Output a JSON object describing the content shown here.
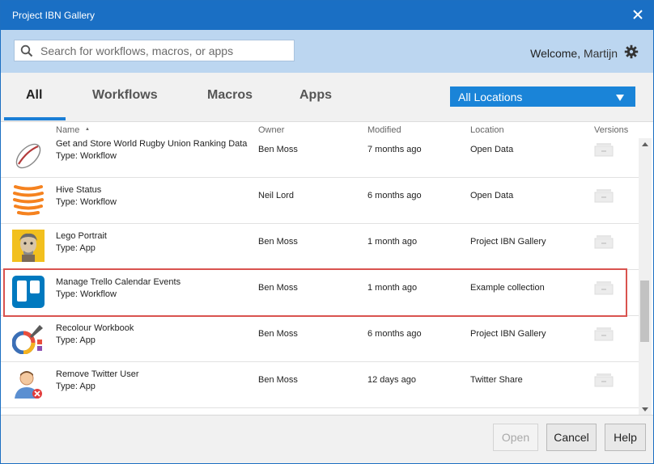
{
  "window": {
    "title": "Project IBN Gallery"
  },
  "search": {
    "placeholder": "Search for workflows, macros, or apps"
  },
  "user": {
    "welcome_label": "Welcome,",
    "name": "Martijn"
  },
  "tabs": [
    {
      "label": "All",
      "active": true
    },
    {
      "label": "Workflows",
      "active": false
    },
    {
      "label": "Macros",
      "active": false
    },
    {
      "label": "Apps",
      "active": false
    }
  ],
  "location_filter": {
    "selected": "All Locations"
  },
  "columns": {
    "name": "Name",
    "sort_indicator": "▲",
    "owner": "Owner",
    "modified": "Modified",
    "location": "Location",
    "versions": "Versions"
  },
  "rows": [
    {
      "name": "Get and Store World Rugby Union Ranking Data",
      "type": "Type: Workflow",
      "owner": "Ben Moss",
      "modified": "7 months ago",
      "location": "Open Data",
      "icon": "rugby-ball-icon"
    },
    {
      "name": "Hive Status",
      "type": "Type: Workflow",
      "owner": "Neil Lord",
      "modified": "6 months ago",
      "location": "Open Data",
      "icon": "hive-icon"
    },
    {
      "name": "Lego Portrait",
      "type": "Type: App",
      "owner": "Ben Moss",
      "modified": "1 month ago",
      "location": "Project IBN Gallery",
      "icon": "portrait-icon"
    },
    {
      "name": "Manage Trello Calendar Events",
      "type": "Type: Workflow",
      "owner": "Ben Moss",
      "modified": "1 month ago",
      "location": "Example collection",
      "icon": "trello-icon",
      "highlighted": true
    },
    {
      "name": "Recolour Workbook",
      "type": "Type: App",
      "owner": "Ben Moss",
      "modified": "6 months ago",
      "location": "Project IBN Gallery",
      "icon": "color-picker-icon"
    },
    {
      "name": "Remove Twitter User",
      "type": "Type: App",
      "owner": "Ben Moss",
      "modified": "12 days ago",
      "location": "Twitter Share",
      "icon": "remove-user-icon"
    }
  ],
  "buttons": {
    "open": "Open",
    "cancel": "Cancel",
    "help": "Help"
  },
  "colors": {
    "titlebar": "#1a6fc4",
    "accent": "#1a84d8",
    "highlight": "#d9534f",
    "hive_orange": "#f5821f",
    "trello_blue": "#0079bf"
  }
}
